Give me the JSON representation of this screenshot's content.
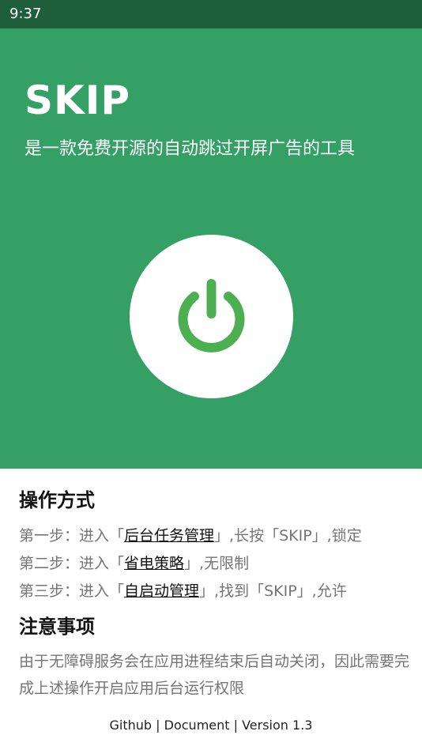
{
  "status_bar": {
    "time": "9:37"
  },
  "header": {
    "title": "SKIP",
    "subtitle": "是一款免费开源的自动跳过开屏广告的工具"
  },
  "power_button": {
    "icon": "power-icon",
    "color": "#4caf50"
  },
  "instructions": {
    "title": "操作方式",
    "steps": [
      {
        "prefix": "第一步：进入「",
        "link": "后台任务管理",
        "suffix": "」,长按「SKIP」,锁定"
      },
      {
        "prefix": "第二步：进入「",
        "link": "省电策略",
        "suffix": "」,无限制"
      },
      {
        "prefix": "第三步：进入「",
        "link": "自启动管理",
        "suffix": "」,找到「SKIP」,允许"
      }
    ]
  },
  "notes": {
    "title": "注意事项",
    "text": "由于无障碍服务会在应用进程结束后自动关闭，因此需要完成上述操作开启应用后台运行权限"
  },
  "footer": {
    "github": "Github",
    "sep1": " | ",
    "document": "Document",
    "sep2": " | ",
    "version": "Version 1.3"
  },
  "colors": {
    "status_bar": "#1f5e3a",
    "hero": "#34a066",
    "power_icon": "#4caf50"
  }
}
